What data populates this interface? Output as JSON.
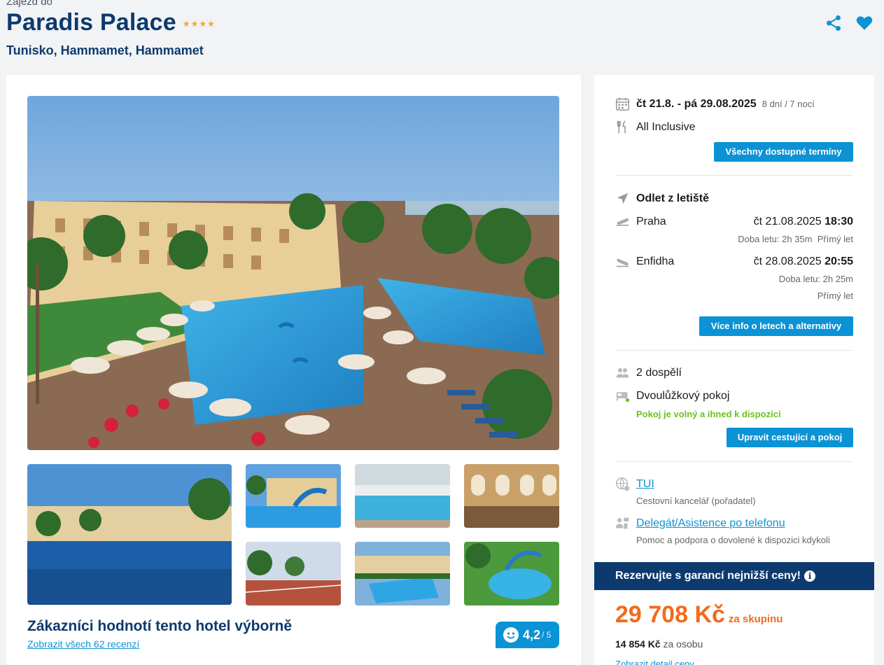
{
  "header": {
    "subtitle": "Zájezd do",
    "hotel_name": "Paradis Palace",
    "stars": "★★★★",
    "location": "Tunisko, Hammamet, Hammamet"
  },
  "gallery": {
    "main_alt": "Hotel pool area",
    "thumbs": [
      "Pool at dusk",
      "Pool with slides",
      "Indoor pool",
      "Lobby",
      "Tennis court",
      "Pool aerial",
      "Water park"
    ]
  },
  "rating": {
    "title": "Zákazníci hodnotí tento hotel výborně",
    "reviews_link": "Zobrazit všech 62 recenzí",
    "score": "4,2",
    "score_max": "/ 5"
  },
  "booking": {
    "dates": "čt 21.8. - pá 29.08.2025",
    "duration": "8 dní / 7 nocí",
    "board": "All Inclusive",
    "all_dates_button": "Všechny dostupné termíny",
    "departure_heading": "Odlet z letiště",
    "outbound": {
      "airport": "Praha",
      "date": "čt 21.08.2025",
      "time": "18:30",
      "duration": "Doba letu: 2h 35m",
      "type": "Přímý let"
    },
    "return": {
      "airport": "Enfidha",
      "date": "čt 28.08.2025",
      "time": "20:55",
      "duration": "Doba letu: 2h 25m",
      "type": "Přímý let"
    },
    "flights_button": "Více info o letech a alternativy",
    "travelers": "2 dospělí",
    "room": "Dvoulůžkový pokoj",
    "availability": "Pokoj je volný a ihned k dispozici",
    "edit_button": "Upravit cestující a pokoj",
    "operator_link": "TUI",
    "operator_desc": "Cestovní kancelář (pořadatel)",
    "assist_link": "Delegát/Asistence po telefonu",
    "assist_desc": "Pomoc a podpora o dovolené k dispozici kdykoli",
    "banner": "Rezervujte s garancí nejnižší ceny!",
    "info_icon": "i",
    "price": "29 708 Kč",
    "price_group": "za skupinu",
    "per_person_price": "14 854 Kč",
    "per_person_label": "za osobu",
    "price_detail_link": "Zobrazit detail ceny"
  },
  "colors": {
    "primary": "#0d3a6e",
    "accent": "#0b93d5",
    "price": "#f26b1d",
    "available": "#6cc11f"
  }
}
